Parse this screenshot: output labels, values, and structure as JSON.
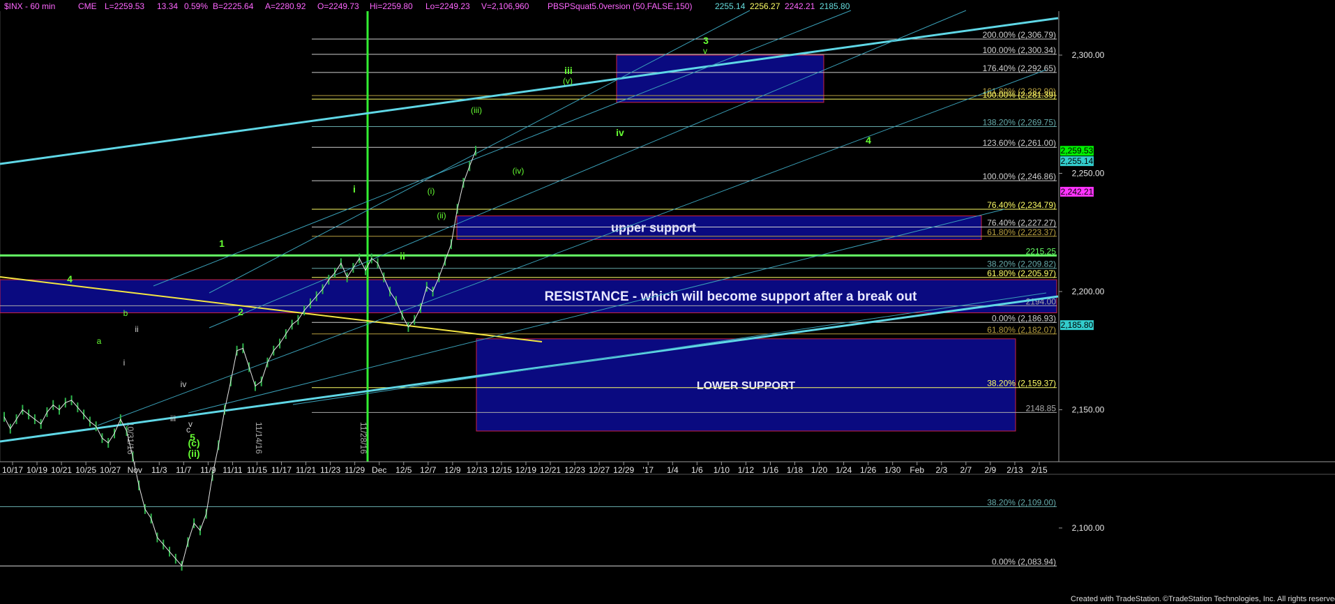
{
  "header": {
    "symbol": "$INX - 60 min",
    "exchange": "CME",
    "last": "L=2259.53",
    "change": "13.34",
    "change_pct": "0.59%",
    "bid": "B=2225.64",
    "ask": "A=2280.92",
    "open": "O=2249.73",
    "high": "Hi=2259.80",
    "low": "Lo=2249.23",
    "volume": "V=2,106,960",
    "study": "PBSPSquat5.0version (50,FALSE,150)",
    "study_v1": "2255.14",
    "study_v2": "2256.27",
    "study_v3": "2242.21",
    "study_v4": "2185.80",
    "colors": {
      "v1": "#66dddd",
      "v2": "#ffff66",
      "v3": "#ff66ff",
      "v4": "#66dddd"
    }
  },
  "footer": {
    "credit": "Created with TradeStation.",
    "copyright": "©TradeStation Technologies, Inc. All rights reserved."
  },
  "chart_data": {
    "type": "line",
    "price_axis": {
      "ticks": [
        "2,300.00",
        "2,250.00",
        "2,200.00",
        "2,150.00",
        "2,100.00"
      ],
      "values": [
        2300,
        2250,
        2200,
        2150,
        2100
      ],
      "ylim": [
        2060,
        2335
      ]
    },
    "date_axis": {
      "ticks": [
        "10/17",
        "10/19",
        "10/21",
        "10/25",
        "10/27",
        "Nov",
        "11/3",
        "11/7",
        "11/9",
        "11/11",
        "11/15",
        "11/17",
        "11/21",
        "11/23",
        "11/29",
        "Dec",
        "12/5",
        "12/7",
        "12/9",
        "12/13",
        "12/15",
        "12/19",
        "12/21",
        "12/23",
        "12/27",
        "12/29",
        "'17",
        "1/4",
        "1/6",
        "1/10",
        "1/12",
        "1/16",
        "1/18",
        "1/20",
        "1/24",
        "1/26",
        "1/30",
        "Feb",
        "2/3",
        "2/7",
        "2/9",
        "2/13",
        "2/15"
      ]
    },
    "vertical_date_labels": [
      {
        "label": "10/31/16",
        "color": "#aaaaaa"
      },
      {
        "label": "11/14/16",
        "color": "#aaaaaa"
      },
      {
        "label": "11/28/16",
        "color": "#aaaaaa"
      }
    ],
    "price_markers": [
      {
        "label": "2,259.53",
        "value": 2259.53,
        "bg": "#00ee00",
        "fg": "#000000"
      },
      {
        "label": "2,255.14",
        "value": 2255.14,
        "bg": "#33cccc",
        "fg": "#000000"
      },
      {
        "label": "2,242.21",
        "value": 2242.21,
        "bg": "#ff33ff",
        "fg": "#000000"
      },
      {
        "label": "2,185.80",
        "value": 2185.8,
        "bg": "#33cccc",
        "fg": "#000000"
      }
    ],
    "levels": [
      {
        "label": "200.00% (2,306.79)",
        "value": 2306.79,
        "color": "#d0d0d0"
      },
      {
        "label": "100.00% (2,300.34)",
        "value": 2300.34,
        "color": "#d0d0d0"
      },
      {
        "label": "176.40% (2,292.65)",
        "value": 2292.65,
        "color": "#d0d0d0"
      },
      {
        "label": "161.80% (2,282.90)",
        "value": 2282.9,
        "color": "#b8a040"
      },
      {
        "label": "100.00% (2,281.39)",
        "value": 2281.39,
        "color": "#ffff66"
      },
      {
        "label": "138.20% (2,269.75)",
        "value": 2269.75,
        "color": "#66aaaa"
      },
      {
        "label": "123.60% (2,261.00)",
        "value": 2261.0,
        "color": "#d0d0d0"
      },
      {
        "label": "100.00% (2,246.86)",
        "value": 2246.86,
        "color": "#d0d0d0"
      },
      {
        "label": "76.40% (2,234.79)",
        "value": 2234.79,
        "color": "#ffff66"
      },
      {
        "label": "76.40% (2,227.27)",
        "value": 2227.27,
        "color": "#d0d0d0"
      },
      {
        "label": "61.80% (2,223.37)",
        "value": 2223.37,
        "color": "#b8a040"
      },
      {
        "label": "2215.25",
        "value": 2215.25,
        "color": "#66ff66"
      },
      {
        "label": "38.20% (2,209.82)",
        "value": 2209.82,
        "color": "#66aaaa"
      },
      {
        "label": "61.80% (2,205.97)",
        "value": 2205.97,
        "color": "#ffff66"
      },
      {
        "label": "2194.00",
        "value": 2194.0,
        "color": "#aaaaaa"
      },
      {
        "label": "0.00% (2,186.93)",
        "value": 2186.93,
        "color": "#d0d0d0"
      },
      {
        "label": "61.80% (2,182.07)",
        "value": 2182.07,
        "color": "#b8a040"
      },
      {
        "label": "38.20% (2,159.37)",
        "value": 2159.37,
        "color": "#ffff66"
      },
      {
        "label": "2148.85",
        "value": 2148.85,
        "color": "#aaaaaa"
      },
      {
        "label": "38.20% (2,109.00)",
        "value": 2109.0,
        "color": "#66aaaa"
      },
      {
        "label": "0.00% (2,083.94)",
        "value": 2083.94,
        "color": "#d0d0d0"
      }
    ],
    "zones": [
      {
        "label": "upper support",
        "top": 2232,
        "bottom": 2222
      },
      {
        "label": "RESISTANCE - which will become support after a break out",
        "top": 2205,
        "bottom": 2191
      },
      {
        "label": "LOWER SUPPORT",
        "top": 2180,
        "bottom": 2141
      },
      {
        "label": "",
        "top": 2300,
        "bottom": 2280
      }
    ],
    "wave_labels": [
      {
        "text": "3",
        "color": "#66ff33",
        "size": "big"
      },
      {
        "text": "v",
        "color": "#66ff33",
        "size": "small"
      },
      {
        "text": "iii",
        "color": "#66ff33",
        "size": "big"
      },
      {
        "text": "(v)",
        "color": "#66ff33",
        "size": "small"
      },
      {
        "text": "(iii)",
        "color": "#66ff33",
        "size": "small"
      },
      {
        "text": "iv",
        "color": "#66ff33",
        "size": "big"
      },
      {
        "text": "4",
        "color": "#66ff33",
        "size": "big"
      },
      {
        "text": "(iv)",
        "color": "#66ff33",
        "size": "small"
      },
      {
        "text": "i",
        "color": "#66ff33",
        "size": "big"
      },
      {
        "text": "(i)",
        "color": "#66ff33",
        "size": "small"
      },
      {
        "text": "(ii)",
        "color": "#66ff33",
        "size": "small"
      },
      {
        "text": "ii",
        "color": "#66ff33",
        "size": "big"
      },
      {
        "text": "1",
        "color": "#66ff33",
        "size": "big"
      },
      {
        "text": "2",
        "color": "#66ff33",
        "size": "big"
      },
      {
        "text": "4",
        "color": "#66ff33",
        "size": "big"
      },
      {
        "text": "a",
        "color": "#66ff33",
        "size": "small"
      },
      {
        "text": "b",
        "color": "#66ff33",
        "size": "small"
      },
      {
        "text": "ii",
        "color": "#d0d0d0",
        "size": "small"
      },
      {
        "text": "i",
        "color": "#d0d0d0",
        "size": "small"
      },
      {
        "text": "iv",
        "color": "#d0d0d0",
        "size": "small"
      },
      {
        "text": "iii",
        "color": "#d0d0d0",
        "size": "small"
      },
      {
        "text": "v",
        "color": "#d0d0d0",
        "size": "small"
      },
      {
        "text": "c",
        "color": "#d0d0d0",
        "size": "small"
      },
      {
        "text": "5",
        "color": "#66ff33",
        "size": "big"
      },
      {
        "text": "(c)",
        "color": "#66ff33",
        "size": "big"
      },
      {
        "text": "(ii)",
        "color": "#66ff33",
        "size": "big"
      }
    ],
    "price_series": [
      2147,
      2142,
      2146,
      2150,
      2148,
      2146,
      2144,
      2149,
      2152,
      2150,
      2153,
      2154,
      2151,
      2148,
      2145,
      2143,
      2138,
      2136,
      2140,
      2146,
      2141,
      2130,
      2118,
      2108,
      2104,
      2096,
      2093,
      2090,
      2087,
      2084,
      2094,
      2102,
      2099,
      2106,
      2122,
      2135,
      2150,
      2162,
      2175,
      2176,
      2168,
      2160,
      2162,
      2170,
      2175,
      2178,
      2182,
      2186,
      2188,
      2192,
      2195,
      2198,
      2201,
      2205,
      2208,
      2212,
      2206,
      2210,
      2214,
      2209,
      2214,
      2212,
      2206,
      2200,
      2196,
      2190,
      2185,
      2188,
      2193,
      2202,
      2200,
      2206,
      2213,
      2220,
      2235,
      2246,
      2253,
      2259.53
    ]
  }
}
